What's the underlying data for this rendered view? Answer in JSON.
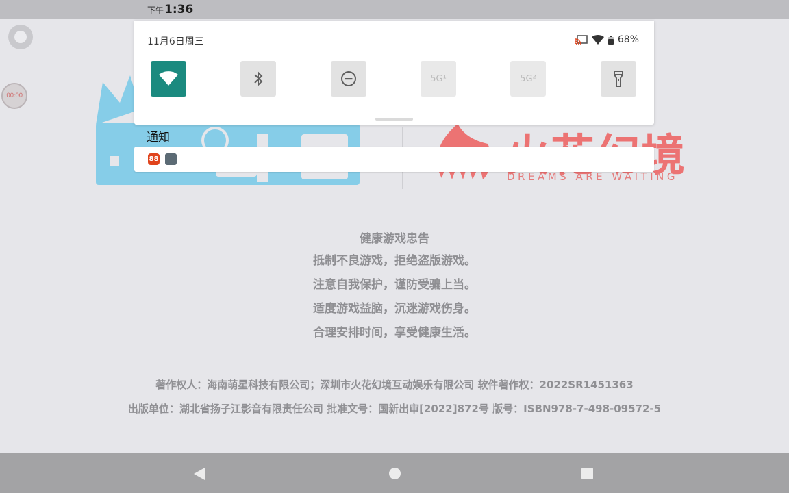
{
  "status_bar": {
    "time_prefix": "下午",
    "time": "1:36"
  },
  "floating": {
    "record_timer": "00:00"
  },
  "quick_settings": {
    "date": "11月6日周三",
    "battery": "68%",
    "tiles": [
      {
        "name": "wifi",
        "icon": "wifi-icon",
        "active": true
      },
      {
        "name": "bluetooth",
        "icon": "bluetooth-icon",
        "active": false
      },
      {
        "name": "do-not-disturb",
        "icon": "do-not-disturb-icon",
        "active": false
      },
      {
        "name": "5g-sim1",
        "label": "5G¹",
        "active": false
      },
      {
        "name": "5g-sim2",
        "label": "5G²",
        "active": false
      },
      {
        "name": "flashlight",
        "icon": "flashlight-icon",
        "active": false
      }
    ],
    "accent_color": "#1b8a7f"
  },
  "notifications": {
    "title": "通知",
    "app_badge": "88"
  },
  "splash": {
    "brand_cn": "火花幻境",
    "tagline": "DREAMS ARE WAITING",
    "health_title": "健康游戏忠告",
    "health_lines": [
      "抵制不良游戏，拒绝盗版游戏。",
      "注意自我保护，谨防受骗上当。",
      "适度游戏益脑，沉迷游戏伤身。",
      "合理安排时间，享受健康生活。"
    ],
    "copyright_1": "著作权人：海南萌星科技有限公司；深圳市火花幻境互动娱乐有限公司 软件著作权：2022SR1451363",
    "copyright_2": "出版单位：湖北省扬子江影音有限责任公司 批准文号：国新出审[2022]872号 版号：ISBN978-7-498-09572-5"
  }
}
